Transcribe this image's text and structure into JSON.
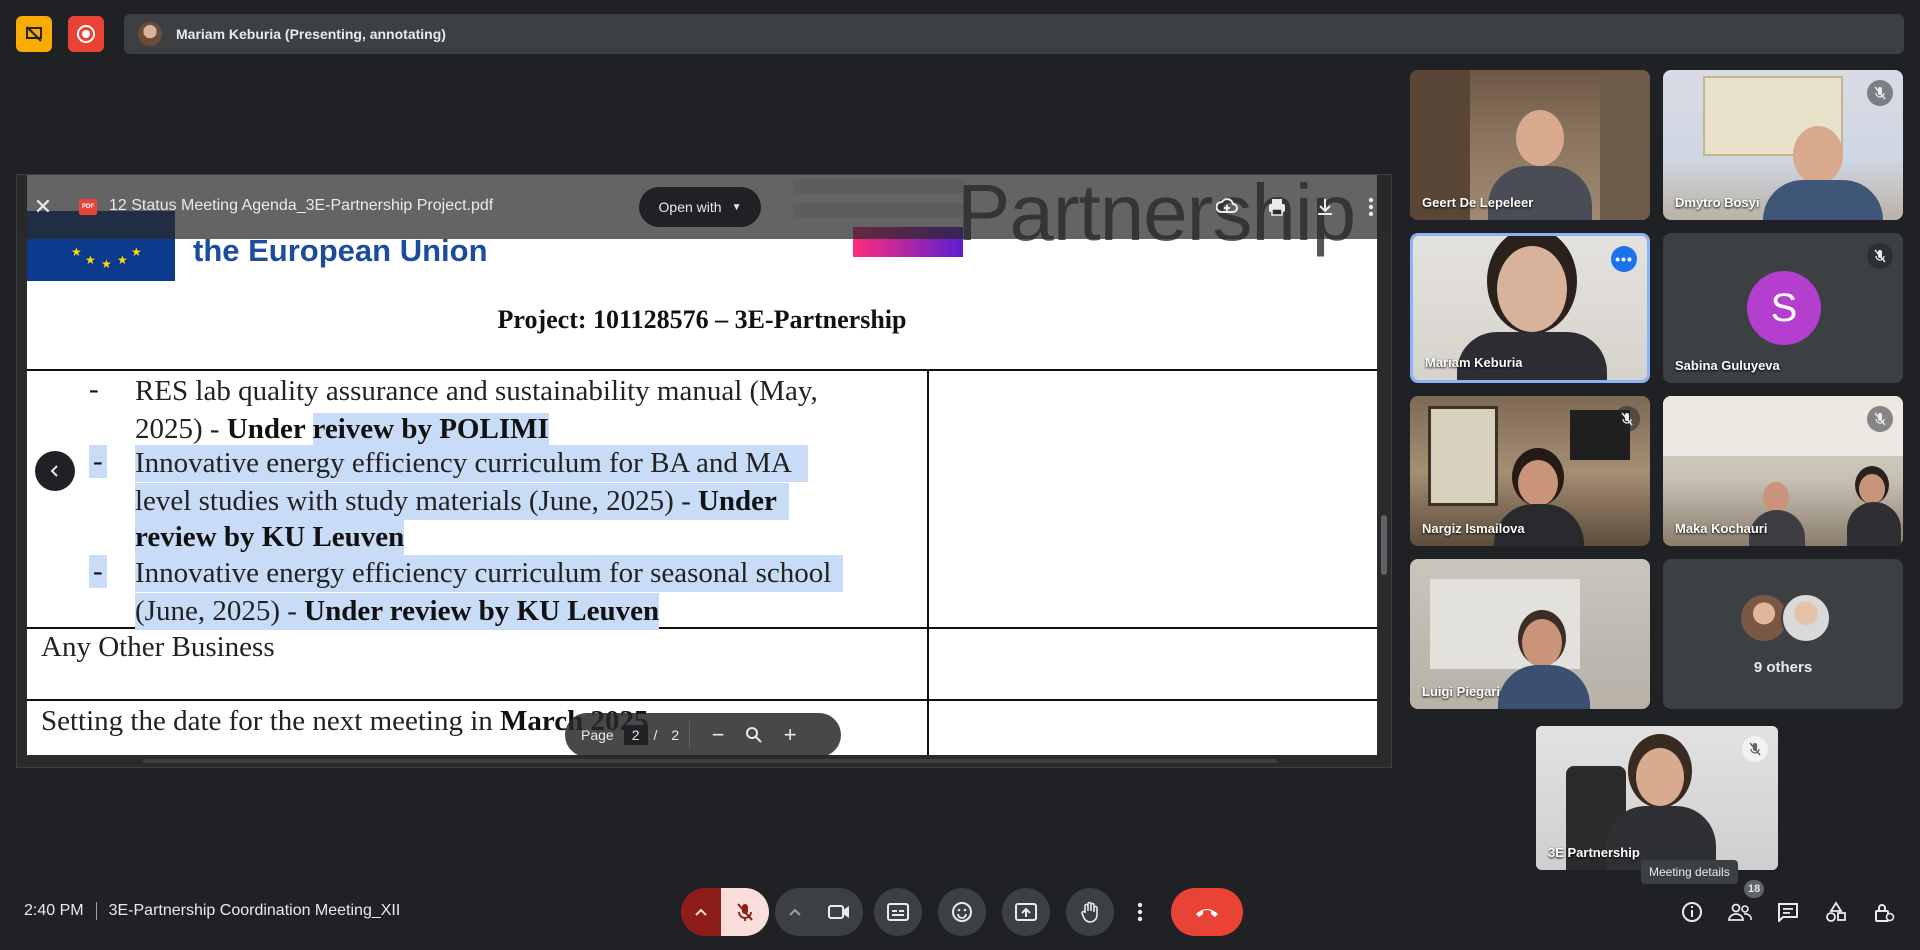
{
  "presenter_bar": {
    "label": "Mariam Keburia (Presenting, annotating)"
  },
  "pdf_viewer": {
    "file_name": "12 Status Meeting Agenda_3E-Partnership Project.pdf",
    "open_with_label": "Open with",
    "pdf_badge": "PDF",
    "pager": {
      "page_label": "Page",
      "current": "2",
      "separator": "/",
      "total": "2"
    }
  },
  "document": {
    "eu_text": "the European Union",
    "brand_text": "Partnership",
    "project_title": "Project: 101128576 – 3E-Partnership",
    "item1_line1": "RES lab quality assurance and sustainability manual (May,",
    "item1_line2_plain": "2025) - ",
    "item1_line2_bold": "Under ",
    "item1_line2_hl": "reivew by POLIMI",
    "item2_line1": "Innovative energy efficiency curriculum for BA and MA",
    "item2_line2_plain": "level studies with study materials (June, 2025) - ",
    "item2_line2_bold": "Under",
    "item2_line3_bold": "review by KU Leuven",
    "item3_line1": "Innovative energy efficiency curriculum for seasonal school",
    "item3_line2_plain": "(June, 2025) - ",
    "item3_line2_bold": "Under review by KU Leuven",
    "aob": "Any Other Business",
    "next_meeting_plain": "Setting the date for the next meeting in ",
    "next_meeting_bold": "March 2025",
    "dash": "-"
  },
  "participants": [
    {
      "name": "Geert De Lepeleer",
      "muted": false
    },
    {
      "name": "Dmytro Bosyi",
      "muted": true
    },
    {
      "name": "Mariam Keburia",
      "muted": false,
      "speaking": true
    },
    {
      "name": "Sabina Guluyeva",
      "muted": true,
      "initial": "S"
    },
    {
      "name": "Nargiz Ismailova",
      "muted": true
    },
    {
      "name": "Maka Kochauri",
      "muted": true
    },
    {
      "name": "Luigi Piegari",
      "muted": false
    },
    {
      "name": "9 others"
    }
  ],
  "self_view": {
    "name": "3E Partnership",
    "muted": true
  },
  "tooltip": "Meeting details",
  "bottom_bar": {
    "time": "2:40 PM",
    "meeting_title": "3E-Partnership Coordination Meeting_XII",
    "people_count": "18"
  },
  "colors": {
    "accent": "#8ab4f8",
    "end_call": "#ea4335",
    "mic_off_bg": "#f9dedc",
    "highlight": "#c9dcf7"
  }
}
